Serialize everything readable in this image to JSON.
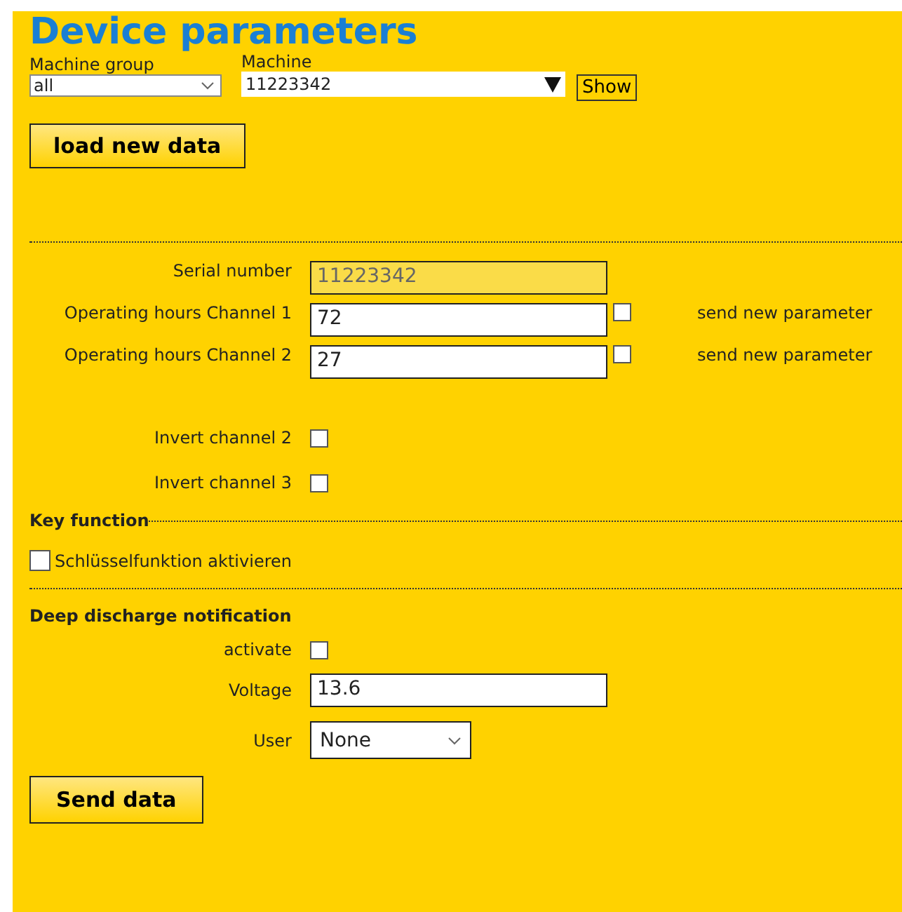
{
  "title": "Device parameters",
  "machine_group": {
    "label": "Machine group",
    "value": "all"
  },
  "machine": {
    "label": "Machine",
    "value": "11223342"
  },
  "show_button": "Show",
  "load_button": "load new data",
  "serial": {
    "label": "Serial number",
    "value": "11223342",
    "disabled": true
  },
  "hours": [
    {
      "label": "Operating hours Channel 1",
      "value": "72",
      "checked": false,
      "note": "send new parameter"
    },
    {
      "label": "Operating hours Channel 2",
      "value": "27",
      "checked": false,
      "note": "send new parameter"
    }
  ],
  "inverts": [
    {
      "label": "Invert channel 2",
      "checked": false
    },
    {
      "label": "Invert channel 3",
      "checked": false
    }
  ],
  "key_function": {
    "heading": "Key function",
    "label": "Schlüsselfunktion aktivieren",
    "checked": false
  },
  "deep_discharge": {
    "heading": "Deep discharge notification",
    "activate": {
      "label": "activate",
      "checked": false
    },
    "voltage": {
      "label": "Voltage",
      "value": "13.6"
    },
    "user": {
      "label": "User",
      "value": "None"
    }
  },
  "send_button": "Send data"
}
